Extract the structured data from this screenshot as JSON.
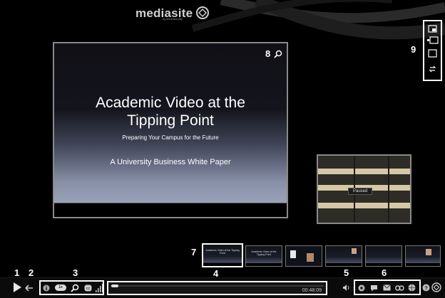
{
  "brand": {
    "name": "mediasite",
    "tagline": "by sonicfoundry"
  },
  "slide": {
    "title": "Academic Video at the\nTipping Point",
    "subtitle": "Preparing Your Campus for the Future",
    "paper": "A University Business White Paper"
  },
  "video": {
    "status": "Paused"
  },
  "thumbnails": [
    {
      "text": "Academic Video at the Tipping Point",
      "selected": true
    },
    {
      "text": "Academic Video at the Tipping Point",
      "selected": false
    },
    {
      "text": "",
      "selected": false
    },
    {
      "text": "",
      "selected": false
    },
    {
      "text": "",
      "selected": false
    },
    {
      "text": "",
      "selected": false
    }
  ],
  "player": {
    "playback_rate": "1x",
    "duration": "00:48:09",
    "progress": 0.0
  },
  "callouts": {
    "n1": "1",
    "n2": "2",
    "n3": "3",
    "n4": "4",
    "n5": "5",
    "n6": "6",
    "n7": "7",
    "n8": "8",
    "n9": "9"
  },
  "icons": [
    "play-icon",
    "back-icon",
    "info-icon",
    "search-icon",
    "captions-icon",
    "bandwidth-icon",
    "volume-icon",
    "chat-icon",
    "comment-icon",
    "email-icon",
    "link-icon",
    "globe-icon",
    "help-icon",
    "zoom-icon",
    "layout-pip-icon",
    "layout-side-icon",
    "layout-single-icon",
    "layout-swap-icon"
  ],
  "colors": {
    "background": "#000000",
    "highlight": "#ffffff"
  }
}
